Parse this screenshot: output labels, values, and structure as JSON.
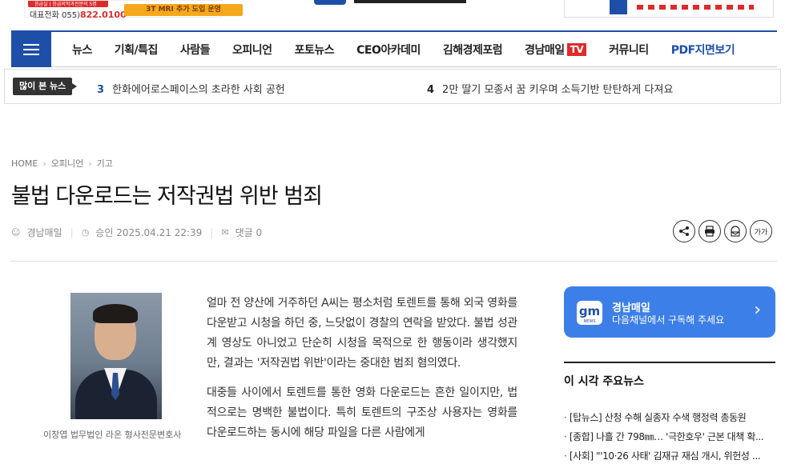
{
  "ads": {
    "left_phone_prefix": "대표전화 055)",
    "left_phone_number": "822.0100",
    "left_top_text": "응급실 | 응급의학과전문의 5명",
    "left_orange_text": "3T MRI 추가 도입 운영"
  },
  "nav": {
    "items": [
      "뉴스",
      "기획/특집",
      "사람들",
      "오피니언",
      "포토뉴스",
      "CEO아카데미",
      "김해경제포럼"
    ],
    "tv_label": "경남매일",
    "tv_badge": "TV",
    "community": "커뮤니티",
    "pdf": "PDF지면보기"
  },
  "ticker": {
    "label": "많이 본 뉴스",
    "items": [
      {
        "num": "3",
        "text": "한화에어로스페이스의 초라한 사회 공헌"
      },
      {
        "num": "4",
        "text": "2만 딸기 모종서 꿈 키우며 소득기반 탄탄하게 다져요"
      }
    ]
  },
  "breadcrumb": {
    "home": "HOME",
    "section": "오피니언",
    "sub": "기고"
  },
  "article": {
    "title": "불법 다운로드는 저작권법 위반 범죄",
    "author": "경남매일",
    "approved": "승인 2025.04.21 22:39",
    "comments": "댓글 0",
    "photo_caption": "이창엽 법무법인 라온 형사전문변호사",
    "paragraphs": [
      "얼마 전 양산에 거주하던 A씨는 평소처럼 토렌트를 통해 외국 영화를 다운받고 시청을 하던 중, 느닷없이 경찰의 연락을 받았다. 불법 성관계 영상도 아니었고 단순히 시청을 목적으로 한 행동이라 생각했지만, 결과는 '저작권법 위반'이라는 중대한 범죄 혐의였다.",
      "대중들 사이에서 토렌트를 통한 영화 다운로드는 흔한 일이지만, 법적으로는 명백한 불법이다. 특히 토렌트의 구조상 사용자는 영화를 다운로드하는 동시에 해당 파일을 다른 사람에게"
    ]
  },
  "tools": {
    "share": "share-icon",
    "print": "print-icon",
    "email": "email-icon",
    "font": "가가"
  },
  "sidebar": {
    "subscribe_title": "경남매일",
    "subscribe_desc": "다음채널에서 구독해 주세요",
    "logo_text": "gm",
    "logo_sub": "NEWS",
    "news_title": "이 시각 주요뉴스",
    "news": [
      "[탑뉴스] 산청 수해 실종자 수색 행정력 총동원",
      "[종합] 나흘 간 798㎜… '극한호우' 근본 대책 확...",
      "[사회] \"'10·26 사태' 김재규 재심 개시, 위헌성 ..."
    ]
  },
  "colors": {
    "brand_blue": "#1e4fa8",
    "accent_red": "#e02a2a",
    "subscribe_blue": "#3d7fe8"
  }
}
